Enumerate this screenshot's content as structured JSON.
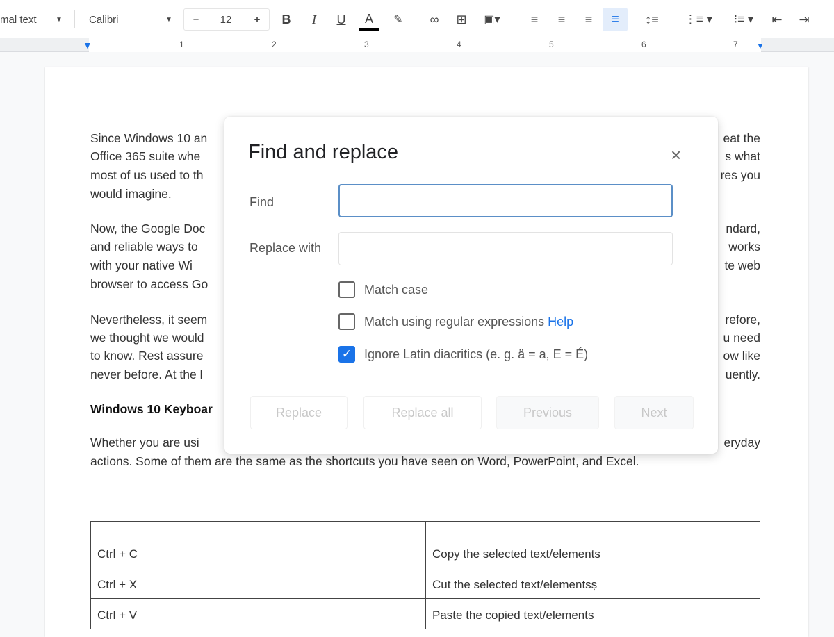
{
  "toolbar": {
    "style": "Normal text",
    "style_visible": "mal text",
    "font": "Calibri",
    "font_size": "12",
    "decrease": "−",
    "increase": "+",
    "bold": "B",
    "italic": "I",
    "underline": "U",
    "text_color": "A"
  },
  "ruler": {
    "numbers": [
      "1",
      "2",
      "3",
      "4",
      "5",
      "6",
      "7"
    ]
  },
  "document": {
    "lines": [
      {
        "left": "Since Windows 10 an",
        "right": "eat the"
      },
      {
        "left": "Office 365 suite whe",
        "right": "s what"
      },
      {
        "left": "most of us used to th",
        "right": "res you"
      },
      {
        "left": "would imagine.",
        "right": ""
      },
      {
        "left": "Now, the Google Doc",
        "right": "ndard,"
      },
      {
        "left": "and reliable ways to",
        "right": "works"
      },
      {
        "left": "with your native Wi",
        "right": "te web"
      },
      {
        "left": "browser to access Go",
        "right": ""
      },
      {
        "left": "Nevertheless, it seem",
        "right": "refore,"
      },
      {
        "left": "we thought we would",
        "right": "u need"
      },
      {
        "left": "to know. Rest assure",
        "right": "ow like"
      },
      {
        "left": "never before. At the l",
        "right": "uently."
      }
    ],
    "heading": "Windows 10 Keyboar",
    "para_last_left": "Whether you are usi",
    "para_last_right": "eryday",
    "para_last_line2": "actions. Some of them are the same as the shortcuts you have seen on Word, PowerPoint, and Excel.",
    "table": [
      [
        "Ctrl + C",
        "Copy the selected text/elements"
      ],
      [
        "Ctrl + X",
        "Cut the selected text/elementsș"
      ],
      [
        "Ctrl + V",
        "Paste the copied text/elements"
      ]
    ]
  },
  "dialog": {
    "title": "Find and replace",
    "close": "×",
    "find_label": "Find",
    "find_value": "",
    "replace_label": "Replace with",
    "replace_value": "",
    "match_case": "Match case",
    "regex": "Match using regular expressions",
    "help": "Help",
    "diacritics": "Ignore Latin diacritics (e. g. ä = a, E = É)",
    "check": "✓",
    "buttons": {
      "replace": "Replace",
      "replace_all": "Replace all",
      "previous": "Previous",
      "next": "Next"
    }
  },
  "colors": {
    "accent": "#1a73e8"
  }
}
